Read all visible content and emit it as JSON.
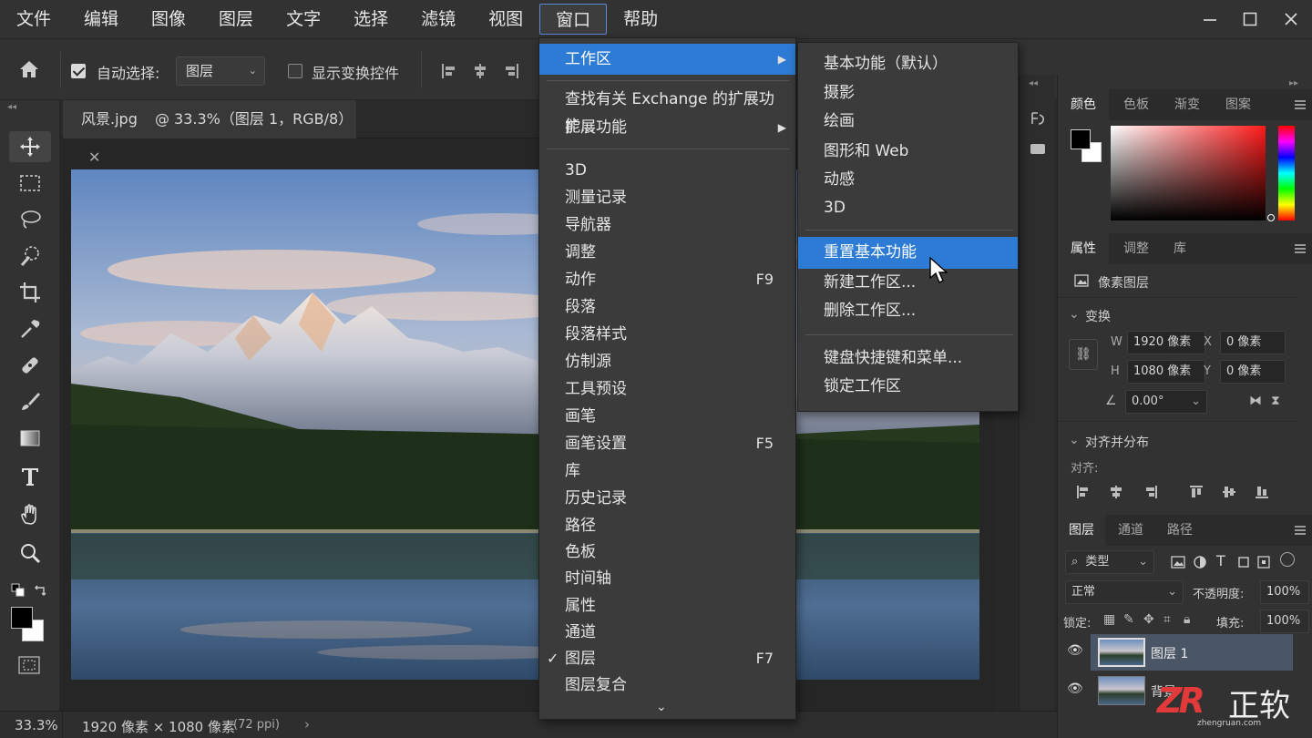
{
  "menubar": {
    "items": [
      "文件",
      "编辑",
      "图像",
      "图层",
      "文字",
      "选择",
      "滤镜",
      "视图",
      "窗口",
      "帮助"
    ],
    "active": "窗口"
  },
  "window_controls": {
    "minimize_icon": "minimize-icon",
    "maximize_icon": "maximize-icon",
    "close_icon": "close-icon"
  },
  "options": {
    "auto_select_label": "自动选择:",
    "auto_select_checked": true,
    "auto_select_target": "图层",
    "show_transform_label": "显示变换控件",
    "show_transform_checked": false
  },
  "document": {
    "tab_title": "风景.jpg",
    "tab_info": "@ 33.3%（图层 1，RGB/8）",
    "zoom": "33.3%",
    "dimensions": "1920 像素 × 1080 像素",
    "resolution": "(72 ppi)"
  },
  "window_menu": {
    "items": [
      {
        "label": "工作区",
        "submenu": true,
        "highlight": true
      },
      {
        "label": "查找有关 Exchange 的扩展功能..."
      },
      {
        "label": "扩展功能",
        "submenu": true
      },
      {
        "label": "3D"
      },
      {
        "label": "测量记录"
      },
      {
        "label": "导航器"
      },
      {
        "label": "调整"
      },
      {
        "label": "动作",
        "shortcut": "F9"
      },
      {
        "label": "段落"
      },
      {
        "label": "段落样式"
      },
      {
        "label": "仿制源"
      },
      {
        "label": "工具预设"
      },
      {
        "label": "画笔"
      },
      {
        "label": "画笔设置",
        "shortcut": "F5"
      },
      {
        "label": "库"
      },
      {
        "label": "历史记录"
      },
      {
        "label": "路径"
      },
      {
        "label": "色板"
      },
      {
        "label": "时间轴"
      },
      {
        "label": "属性"
      },
      {
        "label": "通道"
      },
      {
        "label": "图层",
        "shortcut": "F7",
        "checked": true
      },
      {
        "label": "图层复合"
      }
    ],
    "checkmark": "✓",
    "scroll_icon": "chevron-down-icon"
  },
  "workspace_submenu": {
    "items": [
      "基本功能（默认）",
      "摄影",
      "绘画",
      "图形和 Web",
      "动感",
      "3D",
      "重置基本功能",
      "新建工作区...",
      "删除工作区...",
      "键盘快捷键和菜单...",
      "锁定工作区"
    ],
    "highlight": "重置基本功能"
  },
  "color_panel": {
    "tabs": [
      "颜色",
      "色板",
      "渐变",
      "图案"
    ],
    "foreground": "#000000",
    "background": "#ffffff"
  },
  "properties_panel": {
    "tabs": [
      "属性",
      "调整",
      "库"
    ],
    "layer_type": "像素图层",
    "transform_label": "变换",
    "w_label": "W",
    "w_value": "1920 像素",
    "h_label": "H",
    "h_value": "1080 像素",
    "x_label": "X",
    "x_value": "0 像素",
    "y_label": "Y",
    "y_value": "0 像素",
    "angle": "0.00°",
    "align_section": "对齐并分布",
    "align_label": "对齐:"
  },
  "layers_panel": {
    "tabs": [
      "图层",
      "通道",
      "路径"
    ],
    "filter_label": "类型",
    "blend_mode": "正常",
    "opacity_label": "不透明度:",
    "opacity": "100%",
    "lock_label": "锁定:",
    "fill_label": "填充:",
    "fill": "100%",
    "layers": [
      {
        "name": "图层 1",
        "selected": true
      },
      {
        "name": "背景",
        "selected": false
      }
    ]
  },
  "watermark": {
    "brand": "正软",
    "url": "zhengruan.com"
  },
  "colors": {
    "menu_highlight": "#2d7bd4",
    "panel_bg": "#323232",
    "app_bg": "#282828"
  }
}
